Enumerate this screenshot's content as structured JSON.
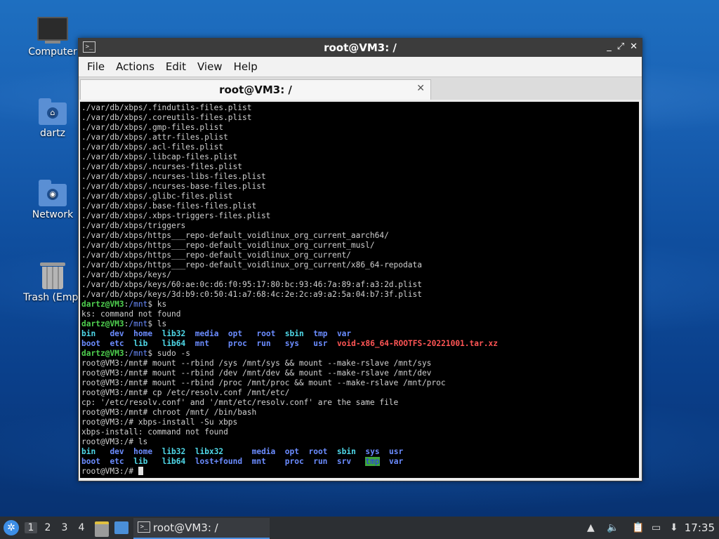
{
  "desktop": {
    "icons": [
      {
        "label": "Computer"
      },
      {
        "label": "dartz"
      },
      {
        "label": "Network"
      },
      {
        "label": "Trash (Empt"
      }
    ]
  },
  "window": {
    "title": "root@VM3: /",
    "controls": {
      "minimize": "_",
      "maximize": "⤢",
      "close": "✕"
    },
    "menu": [
      "File",
      "Actions",
      "Edit",
      "View",
      "Help"
    ],
    "tab": {
      "title": "root@VM3: /",
      "close": "✕"
    }
  },
  "terminal": {
    "lines": [
      [
        {
          "t": "./var/db/xbps/.findutils-files.plist"
        }
      ],
      [
        {
          "t": "./var/db/xbps/.coreutils-files.plist"
        }
      ],
      [
        {
          "t": "./var/db/xbps/.gmp-files.plist"
        }
      ],
      [
        {
          "t": "./var/db/xbps/.attr-files.plist"
        }
      ],
      [
        {
          "t": "./var/db/xbps/.acl-files.plist"
        }
      ],
      [
        {
          "t": "./var/db/xbps/.libcap-files.plist"
        }
      ],
      [
        {
          "t": "./var/db/xbps/.ncurses-files.plist"
        }
      ],
      [
        {
          "t": "./var/db/xbps/.ncurses-libs-files.plist"
        }
      ],
      [
        {
          "t": "./var/db/xbps/.ncurses-base-files.plist"
        }
      ],
      [
        {
          "t": "./var/db/xbps/.glibc-files.plist"
        }
      ],
      [
        {
          "t": "./var/db/xbps/.base-files-files.plist"
        }
      ],
      [
        {
          "t": "./var/db/xbps/.xbps-triggers-files.plist"
        }
      ],
      [
        {
          "t": "./var/db/xbps/triggers"
        }
      ],
      [
        {
          "t": "./var/db/xbps/https___repo-default_voidlinux_org_current_aarch64/"
        }
      ],
      [
        {
          "t": "./var/db/xbps/https___repo-default_voidlinux_org_current_musl/"
        }
      ],
      [
        {
          "t": "./var/db/xbps/https___repo-default_voidlinux_org_current/"
        }
      ],
      [
        {
          "t": "./var/db/xbps/https___repo-default_voidlinux_org_current/x86_64-repodata"
        }
      ],
      [
        {
          "t": "./var/db/xbps/keys/"
        }
      ],
      [
        {
          "t": "./var/db/xbps/keys/60:ae:0c:d6:f0:95:17:80:bc:93:46:7a:89:af:a3:2d.plist"
        }
      ],
      [
        {
          "t": "./var/db/xbps/keys/3d:b9:c0:50:41:a7:68:4c:2e:2c:a9:a2:5a:04:b7:3f.plist"
        }
      ],
      [
        {
          "t": "dartz@VM3",
          "c": "p-user"
        },
        {
          "t": ":"
        },
        {
          "t": "/mnt",
          "c": "p-path"
        },
        {
          "t": "$ ks"
        }
      ],
      [
        {
          "t": "ks: command not found"
        }
      ],
      [
        {
          "t": "dartz@VM3",
          "c": "p-user"
        },
        {
          "t": ":"
        },
        {
          "t": "/mnt",
          "c": "p-path"
        },
        {
          "t": "$ ls"
        }
      ],
      [
        {
          "t": "bin",
          "c": "lnk"
        },
        {
          "t": "   "
        },
        {
          "t": "dev",
          "c": "dir"
        },
        {
          "t": "  "
        },
        {
          "t": "home",
          "c": "dir"
        },
        {
          "t": "  "
        },
        {
          "t": "lib32",
          "c": "lnk"
        },
        {
          "t": "  "
        },
        {
          "t": "media",
          "c": "dir"
        },
        {
          "t": "  "
        },
        {
          "t": "opt",
          "c": "dir"
        },
        {
          "t": "   "
        },
        {
          "t": "root",
          "c": "dir"
        },
        {
          "t": "  "
        },
        {
          "t": "sbin",
          "c": "lnk"
        },
        {
          "t": "  "
        },
        {
          "t": "tmp",
          "c": "dir"
        },
        {
          "t": "  "
        },
        {
          "t": "var",
          "c": "dir"
        }
      ],
      [
        {
          "t": "boot",
          "c": "dir"
        },
        {
          "t": "  "
        },
        {
          "t": "etc",
          "c": "dir"
        },
        {
          "t": "  "
        },
        {
          "t": "lib",
          "c": "lnk"
        },
        {
          "t": "   "
        },
        {
          "t": "lib64",
          "c": "lnk"
        },
        {
          "t": "  "
        },
        {
          "t": "mnt",
          "c": "dir"
        },
        {
          "t": "    "
        },
        {
          "t": "proc",
          "c": "dir"
        },
        {
          "t": "  "
        },
        {
          "t": "run",
          "c": "dir"
        },
        {
          "t": "   "
        },
        {
          "t": "sys",
          "c": "dir"
        },
        {
          "t": "   "
        },
        {
          "t": "usr",
          "c": "dir"
        },
        {
          "t": "  "
        },
        {
          "t": "void-x86_64-ROOTFS-20221001.tar.xz",
          "c": "arc"
        }
      ],
      [
        {
          "t": "dartz@VM3",
          "c": "p-user"
        },
        {
          "t": ":"
        },
        {
          "t": "/mnt",
          "c": "p-path"
        },
        {
          "t": "$ sudo -s"
        }
      ],
      [
        {
          "t": "root@VM3:/mnt# mount --rbind /sys /mnt/sys && mount --make-rslave /mnt/sys"
        }
      ],
      [
        {
          "t": "root@VM3:/mnt# mount --rbind /dev /mnt/dev && mount --make-rslave /mnt/dev"
        }
      ],
      [
        {
          "t": "root@VM3:/mnt# mount --rbind /proc /mnt/proc && mount --make-rslave /mnt/proc"
        }
      ],
      [
        {
          "t": "root@VM3:/mnt# cp /etc/resolv.conf /mnt/etc/"
        }
      ],
      [
        {
          "t": "cp: '/etc/resolv.conf' and '/mnt/etc/resolv.conf' are the same file"
        }
      ],
      [
        {
          "t": "root@VM3:/mnt# chroot /mnt/ /bin/bash"
        }
      ],
      [
        {
          "t": "root@VM3:/# xbps-install -Su xbps"
        }
      ],
      [
        {
          "t": "xbps-install: command not found"
        }
      ],
      [
        {
          "t": "root@VM3:/# ls"
        }
      ],
      [
        {
          "t": "bin",
          "c": "lnk"
        },
        {
          "t": "   "
        },
        {
          "t": "dev",
          "c": "dir"
        },
        {
          "t": "  "
        },
        {
          "t": "home",
          "c": "dir"
        },
        {
          "t": "  "
        },
        {
          "t": "lib32",
          "c": "lnk"
        },
        {
          "t": "  "
        },
        {
          "t": "libx32",
          "c": "lnk"
        },
        {
          "t": "      "
        },
        {
          "t": "media",
          "c": "dir"
        },
        {
          "t": "  "
        },
        {
          "t": "opt",
          "c": "dir"
        },
        {
          "t": "  "
        },
        {
          "t": "root",
          "c": "dir"
        },
        {
          "t": "  "
        },
        {
          "t": "sbin",
          "c": "lnk"
        },
        {
          "t": "  "
        },
        {
          "t": "sys",
          "c": "dir"
        },
        {
          "t": "  "
        },
        {
          "t": "usr",
          "c": "dir"
        }
      ],
      [
        {
          "t": "boot",
          "c": "dir"
        },
        {
          "t": "  "
        },
        {
          "t": "etc",
          "c": "dir"
        },
        {
          "t": "  "
        },
        {
          "t": "lib",
          "c": "lnk"
        },
        {
          "t": "   "
        },
        {
          "t": "lib64",
          "c": "lnk"
        },
        {
          "t": "  "
        },
        {
          "t": "lost+found",
          "c": "dir"
        },
        {
          "t": "  "
        },
        {
          "t": "mnt",
          "c": "dir"
        },
        {
          "t": "    "
        },
        {
          "t": "proc",
          "c": "dir"
        },
        {
          "t": "  "
        },
        {
          "t": "run",
          "c": "dir"
        },
        {
          "t": "  "
        },
        {
          "t": "srv",
          "c": "dir"
        },
        {
          "t": "   "
        },
        {
          "t": "tmp",
          "c": "sticky"
        },
        {
          "t": "  "
        },
        {
          "t": "var",
          "c": "dir"
        }
      ],
      [
        {
          "t": "root@VM3:/# "
        }
      ]
    ]
  },
  "taskbar": {
    "start_icon": "start-menu-icon",
    "workspaces": [
      "1",
      "2",
      "3",
      "4"
    ],
    "active_workspace": "1",
    "task": {
      "title": "root@VM3: /"
    },
    "clock": "17:35"
  },
  "colors": {
    "prompt_user": "#4fd14f",
    "prompt_path": "#6b8cff",
    "directory": "#6b8cff",
    "symlink": "#4fd8e8",
    "archive": "#ff5555",
    "taskbar_accent": "#4a90e2"
  }
}
